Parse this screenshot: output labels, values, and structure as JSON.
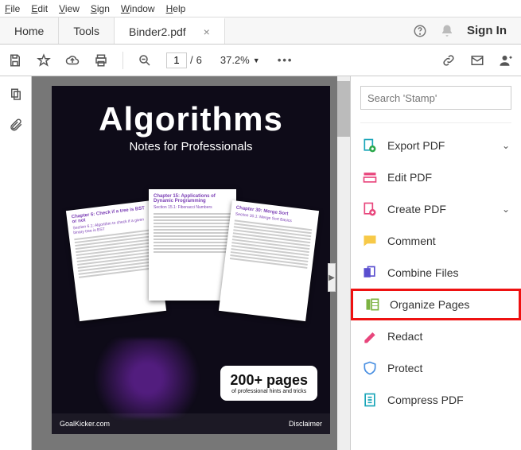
{
  "menu": {
    "file": "File",
    "edit": "Edit",
    "view": "View",
    "sign": "Sign",
    "window": "Window",
    "help": "Help"
  },
  "tabs": {
    "home": "Home",
    "tools": "Tools",
    "doc": "Binder2.pdf"
  },
  "header": {
    "signin": "Sign In"
  },
  "toolbar": {
    "page_current": "1",
    "page_sep": "/",
    "page_total": "6",
    "zoom": "37.2%",
    "more": "•••"
  },
  "search": {
    "placeholder": "Search 'Stamp'"
  },
  "rtools": {
    "export": "Export PDF",
    "edit": "Edit PDF",
    "create": "Create PDF",
    "comment": "Comment",
    "combine": "Combine Files",
    "organize": "Organize Pages",
    "redact": "Redact",
    "protect": "Protect",
    "compress": "Compress PDF"
  },
  "doc": {
    "title": "Algorithms",
    "subtitle": "Notes for Professionals",
    "badge_big": "200+ pages",
    "badge_small": "of professional hints and tricks",
    "footer_left": "GoalKicker.com",
    "footer_right": "Disclaimer",
    "mini1_h": "Chapter 6: Check if a tree is BST or not",
    "mini1_s": "Section 6.1: Algorithm to check if a given binary tree is BST",
    "mini2_h": "Chapter 15: Applications of Dynamic Programming",
    "mini2_s": "Section 15.1: Fibonacci Numbers",
    "mini3_h": "Chapter 30: Merge Sort",
    "mini3_s": "Section 30.1: Merge Sort Basics"
  }
}
